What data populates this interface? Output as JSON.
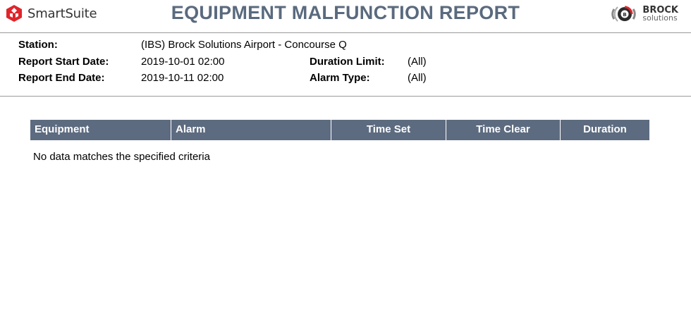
{
  "header": {
    "brand_name": "SmartSuite",
    "brand_icon": "smartsuite-logo-icon",
    "title": "EQUIPMENT MALFUNCTION REPORT",
    "partner_name": "BROCK",
    "partner_sub": "solutions",
    "partner_icon": "brock-logo-icon",
    "title_color": "#5a6a7e",
    "brand_color": "#e0252b"
  },
  "params": {
    "station_label": "Station:",
    "station_value": "(IBS) Brock Solutions Airport - Concourse Q",
    "start_label": "Report Start Date:",
    "start_value": "2019-10-01 02:00",
    "end_label": "Report End Date:",
    "end_value": "2019-10-11 02:00",
    "duration_label": "Duration Limit:",
    "duration_value": "(All)",
    "alarm_label": "Alarm Type:",
    "alarm_value": "(All)"
  },
  "table": {
    "header_color": "#5d6b80",
    "columns": [
      "Equipment",
      "Alarm",
      "Time Set",
      "Time Clear",
      "Duration"
    ],
    "empty_message": "No data matches the specified criteria"
  }
}
